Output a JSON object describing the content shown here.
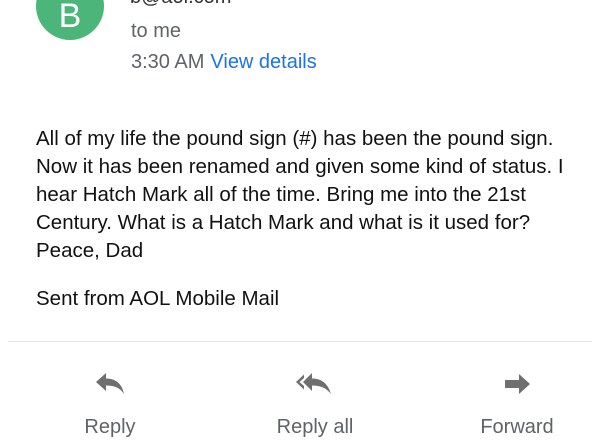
{
  "header": {
    "avatar_letter": "B",
    "sender_email": "b@aol.com",
    "recipient_line": "to me",
    "time": "3:30 AM",
    "details_link": "View details"
  },
  "message": {
    "body": "All of my life the pound sign (#) has been the pound sign.  Now it has been renamed and given some kind of status.  I hear Hatch Mark all of the time.  Bring me into the 21st Century.  What is a Hatch Mark and what is it used for?  Peace,  Dad",
    "signature": "Sent from AOL Mobile Mail"
  },
  "actions": {
    "reply_label": "Reply",
    "reply_all_label": "Reply all",
    "forward_label": "Forward"
  },
  "colors": {
    "avatar": "#4cb57a",
    "link": "#1a73e8",
    "icon": "#6f6f6f"
  }
}
